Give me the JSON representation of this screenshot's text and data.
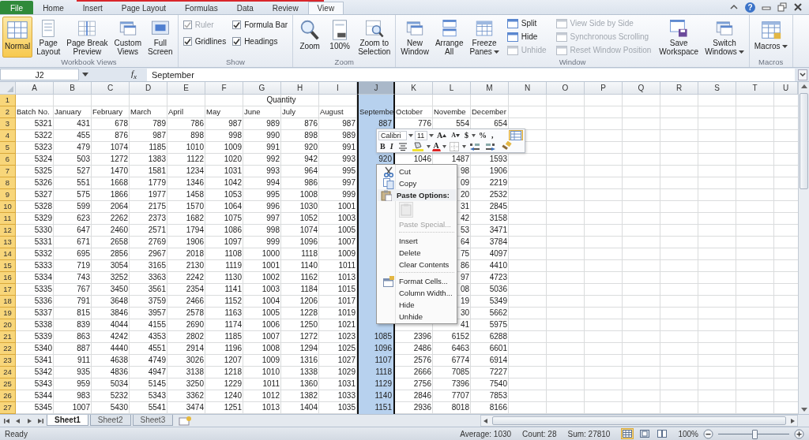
{
  "tabs": [
    {
      "label": "File",
      "kind": "file",
      "selected": false
    },
    {
      "label": "Home",
      "kind": "tab",
      "selected": false
    },
    {
      "label": "Insert",
      "kind": "tab",
      "selected": false
    },
    {
      "label": "Page Layout",
      "kind": "tab",
      "selected": false
    },
    {
      "label": "Formulas",
      "kind": "tab",
      "selected": false
    },
    {
      "label": "Data",
      "kind": "tab",
      "selected": false
    },
    {
      "label": "Review",
      "kind": "tab",
      "selected": false
    },
    {
      "label": "View",
      "kind": "tab",
      "selected": true
    }
  ],
  "window_controls": {
    "help": "?"
  },
  "ribbon": {
    "groups": [
      {
        "title": "Workbook Views",
        "items": [
          {
            "kind": "large",
            "lines": [
              "Normal"
            ],
            "selected": true
          },
          {
            "kind": "large",
            "lines": [
              "Page",
              "Layout"
            ],
            "selected": false
          },
          {
            "kind": "large",
            "lines": [
              "Page Break",
              "Preview"
            ],
            "selected": false
          },
          {
            "kind": "large",
            "lines": [
              "Custom",
              "Views"
            ],
            "selected": false
          },
          {
            "kind": "large",
            "lines": [
              "Full",
              "Screen"
            ],
            "selected": false
          }
        ]
      },
      {
        "title": "Show",
        "items": [
          {
            "kind": "stack",
            "items": [
              {
                "kind": "check",
                "label": "Ruler",
                "checked": true,
                "disabled": true
              },
              {
                "kind": "check",
                "label": "Gridlines",
                "checked": true,
                "disabled": false
              }
            ]
          },
          {
            "kind": "stack",
            "items": [
              {
                "kind": "check",
                "label": "Formula Bar",
                "checked": true,
                "disabled": false
              },
              {
                "kind": "check",
                "label": "Headings",
                "checked": true,
                "disabled": false
              }
            ]
          }
        ]
      },
      {
        "title": "Zoom",
        "items": [
          {
            "kind": "large",
            "lines": [
              "Zoom"
            ]
          },
          {
            "kind": "large",
            "lines": [
              "100%"
            ]
          },
          {
            "kind": "large",
            "lines": [
              "Zoom to",
              "Selection"
            ]
          }
        ]
      },
      {
        "title": "Window",
        "items": [
          {
            "kind": "large",
            "lines": [
              "New",
              "Window"
            ]
          },
          {
            "kind": "large",
            "lines": [
              "Arrange",
              "All"
            ]
          },
          {
            "kind": "large",
            "lines": [
              "Freeze",
              "Panes"
            ],
            "dropdown": true
          },
          {
            "kind": "stack",
            "items": [
              {
                "kind": "small",
                "label": "Split",
                "disabled": false
              },
              {
                "kind": "small",
                "label": "Hide",
                "disabled": false
              },
              {
                "kind": "small",
                "label": "Unhide",
                "disabled": true
              }
            ]
          },
          {
            "kind": "stack",
            "items": [
              {
                "kind": "small",
                "label": "View Side by Side",
                "disabled": true
              },
              {
                "kind": "small",
                "label": "Synchronous Scrolling",
                "disabled": true
              },
              {
                "kind": "small",
                "label": "Reset Window Position",
                "disabled": true
              }
            ]
          },
          {
            "kind": "large",
            "lines": [
              "Save",
              "Workspace"
            ]
          },
          {
            "kind": "large",
            "lines": [
              "Switch",
              "Windows"
            ],
            "dropdown": true
          }
        ]
      },
      {
        "title": "Macros",
        "items": [
          {
            "kind": "large",
            "lines": [
              "Macros"
            ],
            "dropdown": true
          }
        ]
      }
    ]
  },
  "formula_bar": {
    "name_box": "J2",
    "function_label": "f$_{x}$",
    "formula": "September"
  },
  "columns": [
    {
      "letter": "A",
      "selected": false
    },
    {
      "letter": "B",
      "selected": false
    },
    {
      "letter": "C",
      "selected": false
    },
    {
      "letter": "D",
      "selected": false
    },
    {
      "letter": "E",
      "selected": false
    },
    {
      "letter": "F",
      "selected": false
    },
    {
      "letter": "G",
      "selected": false
    },
    {
      "letter": "H",
      "selected": false
    },
    {
      "letter": "I",
      "selected": false
    },
    {
      "letter": "J",
      "selected": true
    },
    {
      "letter": "K",
      "selected": false
    },
    {
      "letter": "L",
      "selected": false
    },
    {
      "letter": "M",
      "selected": false
    },
    {
      "letter": "N",
      "selected": false
    },
    {
      "letter": "O",
      "selected": false
    },
    {
      "letter": "P",
      "selected": false
    },
    {
      "letter": "Q",
      "selected": false
    },
    {
      "letter": "R",
      "selected": false
    },
    {
      "letter": "S",
      "selected": false
    },
    {
      "letter": "T",
      "selected": false
    },
    {
      "letter": "U",
      "selected": false
    }
  ],
  "rows": [
    {
      "number": "1",
      "kind": "title",
      "selected": true,
      "cells": [
        null,
        null,
        null,
        null,
        null,
        null,
        "Quantity"
      ]
    },
    {
      "number": "2",
      "kind": "header",
      "selected": true,
      "cells": [
        "Batch No.",
        "January",
        "February",
        "March",
        "April",
        "May",
        "June",
        "July",
        "August",
        "Septembe",
        "October",
        "Novembe",
        "December"
      ]
    },
    {
      "number": "3",
      "kind": "data",
      "selected": true,
      "cells": [
        "5321",
        "431",
        "678",
        "789",
        "786",
        "987",
        "989",
        "876",
        "987",
        "887",
        "776",
        "554",
        "654"
      ]
    },
    {
      "number": "4",
      "kind": "data",
      "selected": true,
      "cells": [
        "5322",
        "455",
        "876",
        "987",
        "898",
        "998",
        "990",
        "898",
        "989"
      ]
    },
    {
      "number": "5",
      "kind": "data",
      "selected": true,
      "cells": [
        "5323",
        "479",
        "1074",
        "1185",
        "1010",
        "1009",
        "991",
        "920",
        "991"
      ]
    },
    {
      "number": "6",
      "kind": "data",
      "selected": true,
      "cells": [
        "5324",
        "503",
        "1272",
        "1383",
        "1122",
        "1020",
        "992",
        "942",
        "993",
        "920",
        "1046",
        "1487",
        "1593"
      ]
    },
    {
      "number": "7",
      "kind": "data",
      "selected": true,
      "cells": [
        "5325",
        "527",
        "1470",
        "1581",
        "1234",
        "1031",
        "993",
        "964",
        "995",
        null,
        null,
        "98",
        "1906"
      ]
    },
    {
      "number": "8",
      "kind": "data",
      "selected": true,
      "cells": [
        "5326",
        "551",
        "1668",
        "1779",
        "1346",
        "1042",
        "994",
        "986",
        "997",
        null,
        null,
        "09",
        "2219"
      ]
    },
    {
      "number": "9",
      "kind": "data",
      "selected": true,
      "cells": [
        "5327",
        "575",
        "1866",
        "1977",
        "1458",
        "1053",
        "995",
        "1008",
        "999",
        null,
        null,
        "20",
        "2532"
      ]
    },
    {
      "number": "10",
      "kind": "data",
      "selected": true,
      "cells": [
        "5328",
        "599",
        "2064",
        "2175",
        "1570",
        "1064",
        "996",
        "1030",
        "1001",
        null,
        null,
        "31",
        "2845"
      ]
    },
    {
      "number": "11",
      "kind": "data",
      "selected": true,
      "cells": [
        "5329",
        "623",
        "2262",
        "2373",
        "1682",
        "1075",
        "997",
        "1052",
        "1003",
        null,
        null,
        "42",
        "3158"
      ]
    },
    {
      "number": "12",
      "kind": "data",
      "selected": true,
      "cells": [
        "5330",
        "647",
        "2460",
        "2571",
        "1794",
        "1086",
        "998",
        "1074",
        "1005",
        null,
        null,
        "53",
        "3471"
      ]
    },
    {
      "number": "13",
      "kind": "data",
      "selected": true,
      "cells": [
        "5331",
        "671",
        "2658",
        "2769",
        "1906",
        "1097",
        "999",
        "1096",
        "1007",
        null,
        null,
        "64",
        "3784"
      ]
    },
    {
      "number": "14",
      "kind": "data",
      "selected": true,
      "cells": [
        "5332",
        "695",
        "2856",
        "2967",
        "2018",
        "1108",
        "1000",
        "1118",
        "1009",
        null,
        null,
        "75",
        "4097"
      ]
    },
    {
      "number": "15",
      "kind": "data",
      "selected": true,
      "cells": [
        "5333",
        "719",
        "3054",
        "3165",
        "2130",
        "1119",
        "1001",
        "1140",
        "1011",
        null,
        null,
        "86",
        "4410"
      ]
    },
    {
      "number": "16",
      "kind": "data",
      "selected": true,
      "cells": [
        "5334",
        "743",
        "3252",
        "3363",
        "2242",
        "1130",
        "1002",
        "1162",
        "1013",
        null,
        null,
        "97",
        "4723"
      ]
    },
    {
      "number": "17",
      "kind": "data",
      "selected": true,
      "cells": [
        "5335",
        "767",
        "3450",
        "3561",
        "2354",
        "1141",
        "1003",
        "1184",
        "1015",
        null,
        null,
        "08",
        "5036"
      ]
    },
    {
      "number": "18",
      "kind": "data",
      "selected": true,
      "cells": [
        "5336",
        "791",
        "3648",
        "3759",
        "2466",
        "1152",
        "1004",
        "1206",
        "1017",
        null,
        null,
        "19",
        "5349"
      ]
    },
    {
      "number": "19",
      "kind": "data",
      "selected": true,
      "cells": [
        "5337",
        "815",
        "3846",
        "3957",
        "2578",
        "1163",
        "1005",
        "1228",
        "1019",
        null,
        null,
        "30",
        "5662"
      ]
    },
    {
      "number": "20",
      "kind": "data",
      "selected": true,
      "cells": [
        "5338",
        "839",
        "4044",
        "4155",
        "2690",
        "1174",
        "1006",
        "1250",
        "1021",
        null,
        null,
        "41",
        "5975"
      ]
    },
    {
      "number": "21",
      "kind": "data",
      "selected": true,
      "cells": [
        "5339",
        "863",
        "4242",
        "4353",
        "2802",
        "1185",
        "1007",
        "1272",
        "1023",
        "1085",
        "2396",
        "6152",
        "6288"
      ]
    },
    {
      "number": "22",
      "kind": "data",
      "selected": true,
      "cells": [
        "5340",
        "887",
        "4440",
        "4551",
        "2914",
        "1196",
        "1008",
        "1294",
        "1025",
        "1096",
        "2486",
        "6463",
        "6601"
      ]
    },
    {
      "number": "23",
      "kind": "data",
      "selected": true,
      "cells": [
        "5341",
        "911",
        "4638",
        "4749",
        "3026",
        "1207",
        "1009",
        "1316",
        "1027",
        "1107",
        "2576",
        "6774",
        "6914"
      ]
    },
    {
      "number": "24",
      "kind": "data",
      "selected": true,
      "cells": [
        "5342",
        "935",
        "4836",
        "4947",
        "3138",
        "1218",
        "1010",
        "1338",
        "1029",
        "1118",
        "2666",
        "7085",
        "7227"
      ]
    },
    {
      "number": "25",
      "kind": "data",
      "selected": true,
      "cells": [
        "5343",
        "959",
        "5034",
        "5145",
        "3250",
        "1229",
        "1011",
        "1360",
        "1031",
        "1129",
        "2756",
        "7396",
        "7540"
      ]
    },
    {
      "number": "26",
      "kind": "data",
      "selected": true,
      "cells": [
        "5344",
        "983",
        "5232",
        "5343",
        "3362",
        "1240",
        "1012",
        "1382",
        "1033",
        "1140",
        "2846",
        "7707",
        "7853"
      ]
    },
    {
      "number": "27",
      "kind": "data",
      "selected": true,
      "cells": [
        "5345",
        "1007",
        "5430",
        "5541",
        "3474",
        "1251",
        "1013",
        "1404",
        "1035",
        "1151",
        "2936",
        "8018",
        "8166"
      ]
    }
  ],
  "mini_toolbar": {
    "font": "Calibri",
    "size": "11",
    "row_1": [
      {
        "kind": "grow",
        "text": "A"
      },
      {
        "kind": "shrink",
        "text": "A"
      },
      {
        "kind": "currency",
        "text": "$",
        "dropdown": true
      },
      {
        "kind": "percent",
        "text": "%"
      },
      {
        "kind": "comma",
        "text": ","
      },
      {
        "kind": "format"
      }
    ],
    "row_2": [
      {
        "kind": "bold",
        "text": "B"
      },
      {
        "kind": "italic",
        "text": "I"
      },
      {
        "kind": "center"
      },
      {
        "kind": "fill",
        "dropdown": true
      },
      {
        "kind": "font-color",
        "text": "A",
        "dropdown": true
      },
      {
        "kind": "borders",
        "dropdown": true
      },
      {
        "kind": "increase-decimal"
      },
      {
        "kind": "decrease-decimal"
      },
      {
        "kind": "painter"
      }
    ]
  },
  "context_menu": [
    {
      "kind": "cut",
      "label": "Cut",
      "disabled": false
    },
    {
      "kind": "copy",
      "label": "Copy",
      "disabled": false
    },
    {
      "kind": "header",
      "label": "Paste Options:"
    },
    {
      "kind": "paste-button",
      "disabled": true
    },
    {
      "kind": "command",
      "label": "Paste Special...",
      "disabled": true
    },
    {
      "kind": "separator"
    },
    {
      "kind": "command",
      "label": "Insert",
      "disabled": false
    },
    {
      "kind": "command",
      "label": "Delete",
      "disabled": false
    },
    {
      "kind": "command",
      "label": "Clear Contents",
      "disabled": false
    },
    {
      "kind": "separator"
    },
    {
      "kind": "format-cells",
      "label": "Format Cells...",
      "disabled": false
    },
    {
      "kind": "command",
      "label": "Column Width...",
      "disabled": false
    },
    {
      "kind": "command",
      "label": "Hide",
      "disabled": false
    },
    {
      "kind": "command",
      "label": "Unhide",
      "disabled": false
    }
  ],
  "sheet_tabs": [
    {
      "label": "Sheet1",
      "selected": true
    },
    {
      "label": "Sheet2",
      "selected": false
    },
    {
      "label": "Sheet3",
      "selected": false
    }
  ],
  "status_bar": {
    "mode": "Ready",
    "summaries": [
      "Average: 1030",
      "Count: 28",
      "Sum: 27810"
    ],
    "views": [
      {
        "kind": "normal",
        "selected": true
      },
      {
        "kind": "page-layout",
        "selected": false
      },
      {
        "kind": "page-break",
        "selected": false
      }
    ],
    "zoom": "100%",
    "zoom_slider": {
      "level": 0.5
    }
  }
}
